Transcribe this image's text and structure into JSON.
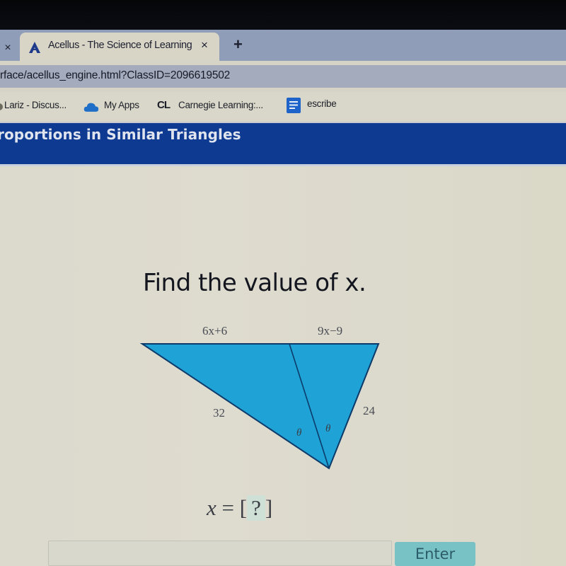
{
  "browser": {
    "prev_tab_close_icon": "close-icon",
    "active_tab": {
      "favicon": "acellus-logo-icon",
      "title": "Acellus - The Science of Learning",
      "close_icon": "close-icon"
    },
    "new_tab_icon": "plus-icon",
    "new_tab_symbol": "+",
    "close_symbol": "×",
    "address_bar": {
      "url": "rface/acellus_engine.html?ClassID=2096619502"
    },
    "bookmarks": [
      {
        "label": "Lariz - Discus...",
        "icon": "bookmark-icon"
      },
      {
        "label": "My Apps",
        "icon": "cloud-icon"
      },
      {
        "label": "Carnegie Learning:...",
        "icon": "carnegie-learning-icon",
        "icon_text": "CL"
      },
      {
        "label": "escribe",
        "icon": "document-icon"
      }
    ]
  },
  "lesson": {
    "title": "roportions in Similar Triangles"
  },
  "problem": {
    "prompt": "Find the value of x.",
    "figure": {
      "top_left_segment": "6x+6",
      "top_right_segment": "9x−9",
      "left_side": "32",
      "right_side": "24",
      "angle_label_left": "θ",
      "angle_label_right": "θ",
      "fill_color": "#1fa3d6",
      "stroke_color": "#0c3a6a"
    },
    "equation": {
      "variable": "x",
      "equals": "=",
      "open_bracket": "[",
      "placeholder": "?",
      "close_bracket": "]"
    },
    "answer_input": {
      "value": "",
      "placeholder": ""
    },
    "enter_label": "Enter"
  },
  "colors": {
    "header_band": "#0e3a92",
    "enter_button": "#78c2c6",
    "tab_strip": "#8f9db8"
  }
}
